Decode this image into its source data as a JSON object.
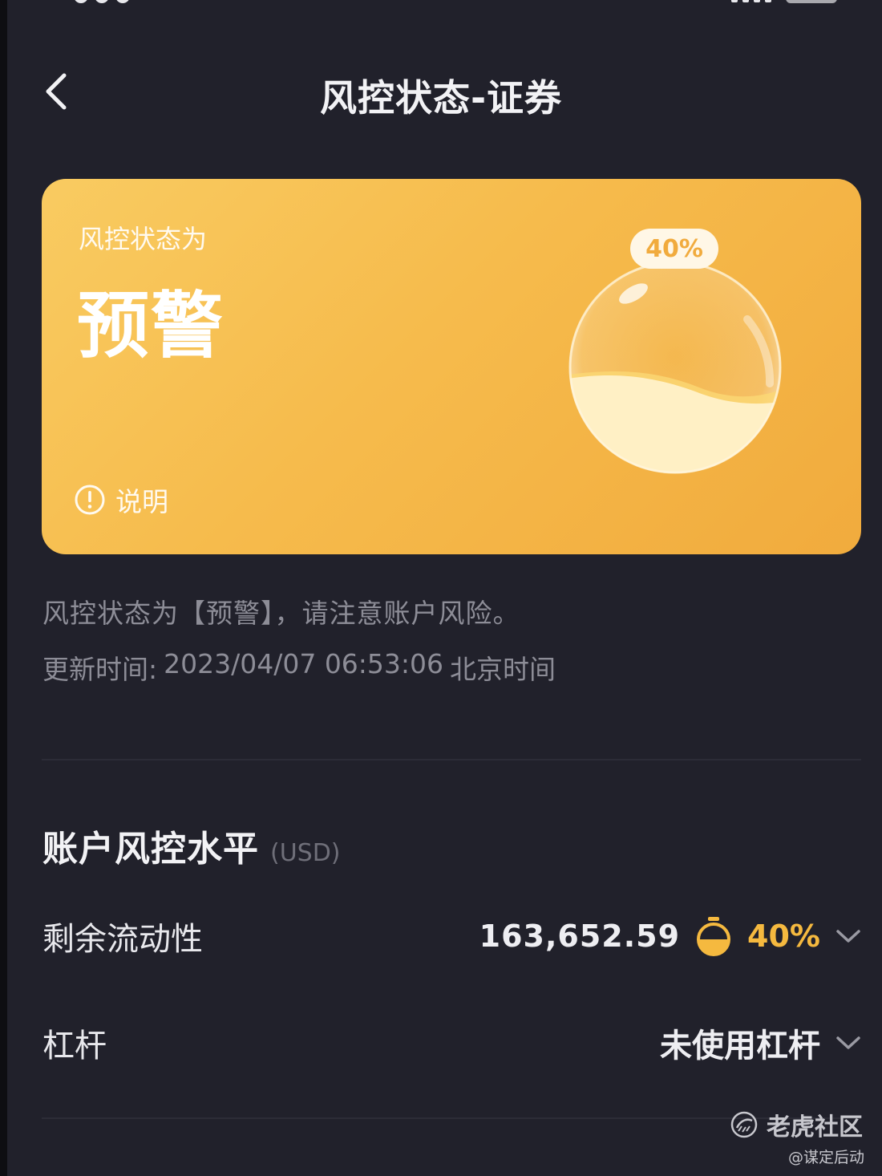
{
  "header": {
    "title": "风控状态-证券",
    "back_icon": "chevron-left-icon"
  },
  "card": {
    "label": "风控状态为",
    "status": "预警",
    "percent": "40%",
    "fill_fraction": 0.4,
    "explain_label": "说明",
    "colors": {
      "start": "#f9cb61",
      "end": "#f1ab3d"
    }
  },
  "description": {
    "line1": "风控状态为【预警】，请注意账户风险。",
    "update_label": "更新时间:",
    "update_time": "2023/04/07 06:53:06",
    "timezone": "北京时间"
  },
  "section": {
    "title": "账户风控水平",
    "unit": "(USD)"
  },
  "rows": {
    "liquidity": {
      "label": "剩余流动性",
      "value": "163,652.59",
      "percent": "40%",
      "accent": "#f5b93f"
    },
    "leverage": {
      "label": "杠杆",
      "value": "未使用杠杆"
    }
  },
  "watermark": {
    "name": "老虎社区",
    "user": "@谋定后动"
  }
}
